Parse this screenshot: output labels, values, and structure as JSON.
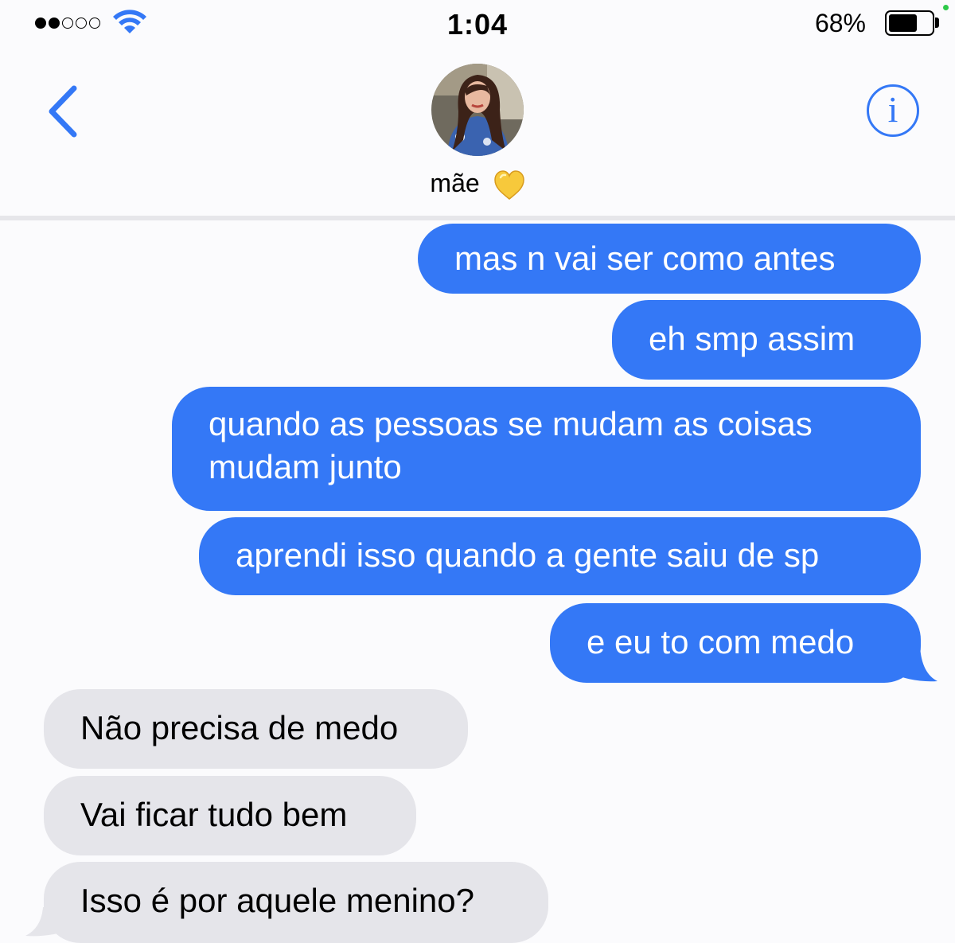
{
  "status_bar": {
    "time": "1:04",
    "battery_percent": "68%",
    "battery_level": 0.68,
    "signal_bars_filled": 2,
    "signal_bars_total": 5
  },
  "header": {
    "contact_name": "mãe",
    "contact_emoji": "yellow-heart-icon"
  },
  "colors": {
    "accent": "#3478f6",
    "sent_bubble": "#3478f6",
    "received_bubble": "#e5e5ea"
  },
  "messages": [
    {
      "direction": "sent",
      "text": "mas n vai ser como antes"
    },
    {
      "direction": "sent",
      "text": "eh smp assim"
    },
    {
      "direction": "sent",
      "text": "quando as pessoas se mudam as coisas mudam junto"
    },
    {
      "direction": "sent",
      "text": "aprendi isso quando a gente saiu de sp"
    },
    {
      "direction": "sent",
      "text": "e eu to com medo"
    },
    {
      "direction": "received",
      "text": "Não precisa de medo"
    },
    {
      "direction": "received",
      "text": "Vai ficar tudo bem"
    },
    {
      "direction": "received",
      "text": "Isso é por aquele menino?"
    }
  ]
}
